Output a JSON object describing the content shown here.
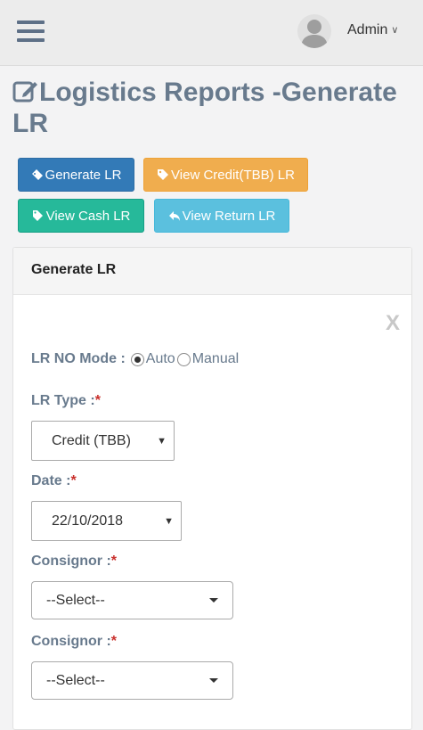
{
  "header": {
    "user_name": "Admin",
    "icons": [
      "menu-icon",
      "avatar-icon",
      "chevron-down-icon"
    ]
  },
  "page": {
    "title": "Logistics Reports -Generate LR"
  },
  "actions": {
    "generate_label": "Generate LR",
    "credit_label": "View Credit(TBB) LR",
    "cash_label": "View Cash LR",
    "return_label": "View Return LR"
  },
  "form": {
    "heading": "Generate LR",
    "close_label": "X",
    "lr_mode_label": "LR NO Mode :",
    "mode_auto": "Auto",
    "mode_manual": "Manual",
    "mode_selected": "Auto",
    "lr_type_label": "LR Type :",
    "lr_type_value": "Credit (TBB)",
    "date_label": "Date :",
    "date_value": "22/10/2018",
    "consignor_label": "Consignor :",
    "consignor_value": "--Select--",
    "consignor2_label": "Consignor :",
    "consignor2_value": "--Select--",
    "required_mark": "*"
  },
  "colors": {
    "primary": "#337ab7",
    "warning": "#f0ad4e",
    "success": "#26b99a",
    "info": "#5bc0de",
    "title": "#687a8d",
    "required": "#c9302c"
  }
}
